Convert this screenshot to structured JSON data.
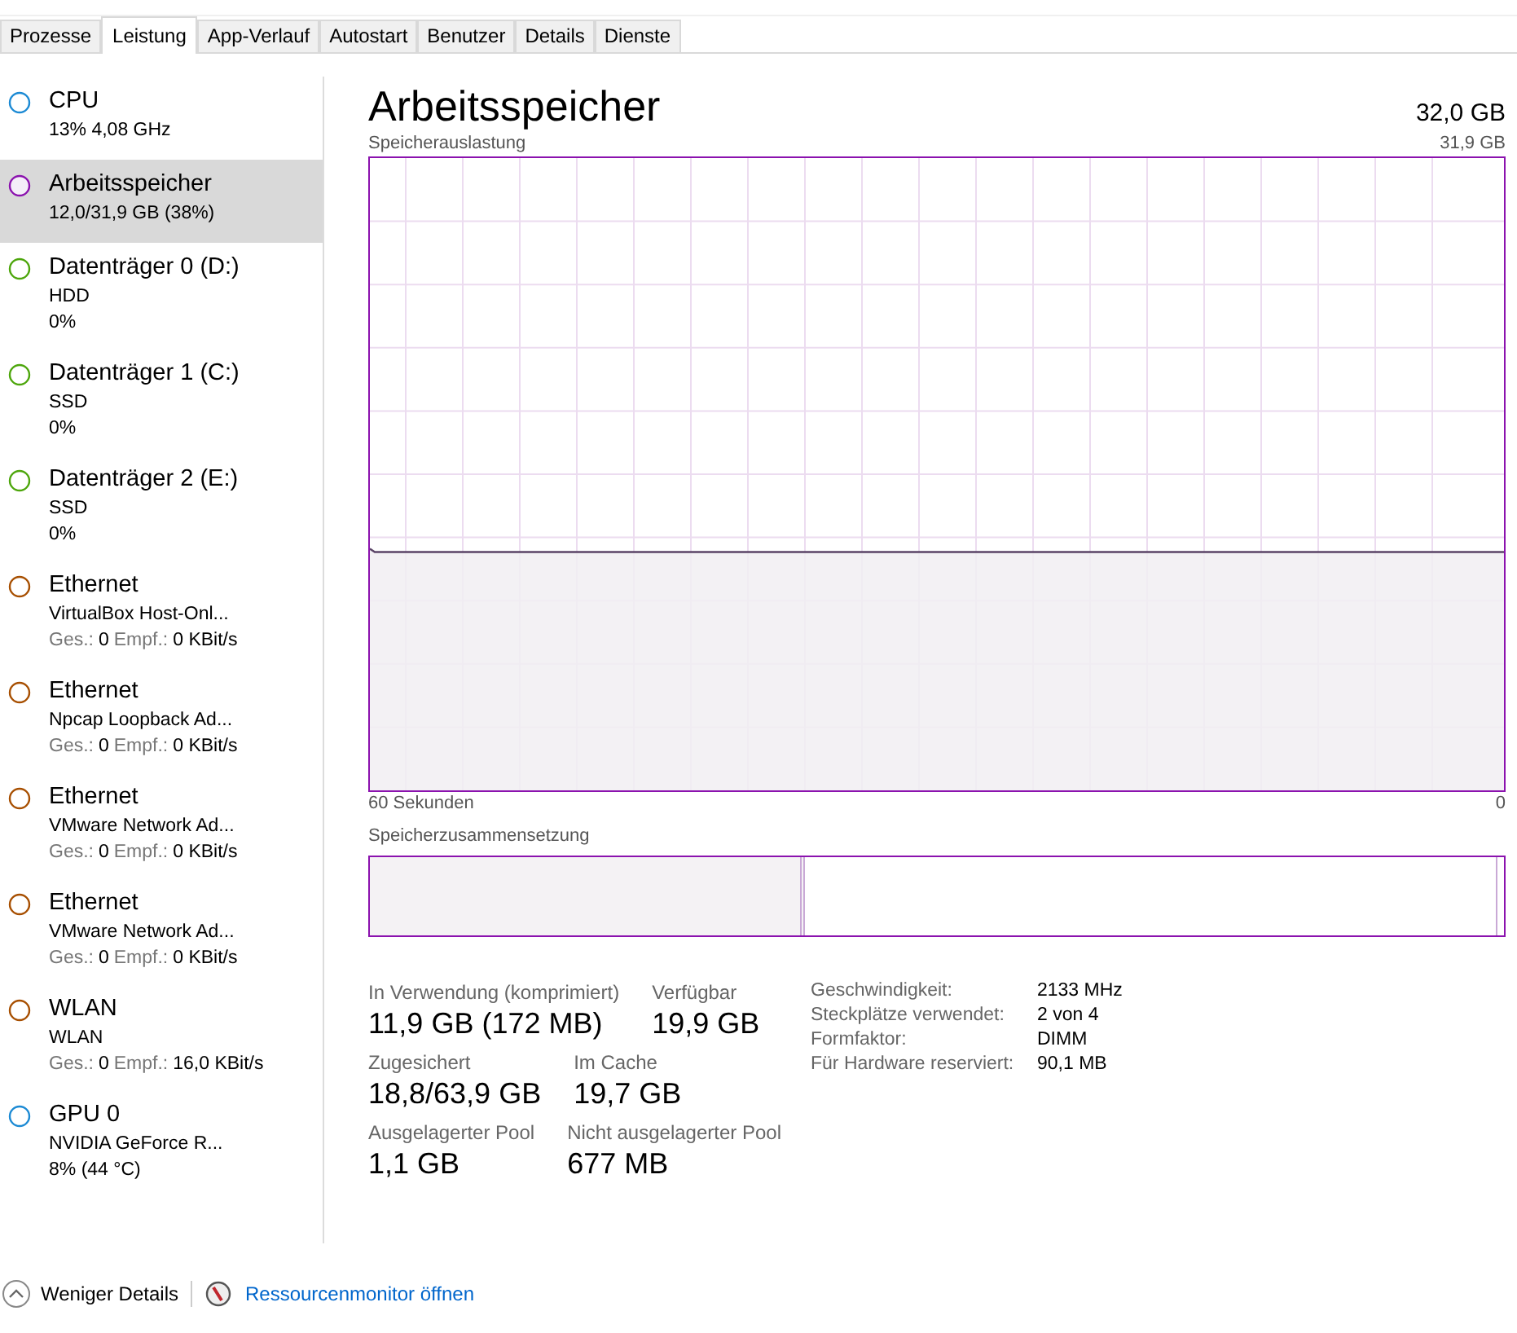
{
  "tabs": [
    {
      "label": "Prozesse",
      "selected": false
    },
    {
      "label": "Leistung",
      "selected": true
    },
    {
      "label": "App-Verlauf",
      "selected": false
    },
    {
      "label": "Autostart",
      "selected": false
    },
    {
      "label": "Benutzer",
      "selected": false
    },
    {
      "label": "Details",
      "selected": false
    },
    {
      "label": "Dienste",
      "selected": false
    }
  ],
  "sidebar": {
    "items": [
      {
        "name": "CPU",
        "color": "#1c8ad4",
        "selected": false,
        "lines": [
          {
            "kind": "text",
            "text": "13%  4,08 GHz"
          }
        ]
      },
      {
        "name": "Arbeitsspeicher",
        "color": "#8b12ae",
        "selected": true,
        "lines": [
          {
            "kind": "text",
            "text": "12,0/31,9 GB (38%)"
          }
        ]
      },
      {
        "name": "Datenträger 0 (D:)",
        "color": "#4da60c",
        "selected": false,
        "lines": [
          {
            "kind": "text",
            "text": "HDD"
          },
          {
            "kind": "text",
            "text": "0%"
          }
        ]
      },
      {
        "name": "Datenträger 1 (C:)",
        "color": "#4da60c",
        "selected": false,
        "lines": [
          {
            "kind": "text",
            "text": "SSD"
          },
          {
            "kind": "text",
            "text": "0%"
          }
        ]
      },
      {
        "name": "Datenträger 2 (E:)",
        "color": "#4da60c",
        "selected": false,
        "lines": [
          {
            "kind": "text",
            "text": "SSD"
          },
          {
            "kind": "text",
            "text": "0%"
          }
        ]
      },
      {
        "name": "Ethernet",
        "color": "#a74f01",
        "selected": false,
        "lines": [
          {
            "kind": "text",
            "text": "VirtualBox Host-Onl..."
          },
          {
            "kind": "throughput",
            "parts": [
              {
                "label": "Ges.:",
                "value": "0"
              },
              {
                "label": "Empf.:",
                "value": "0 KBit/s"
              }
            ]
          }
        ]
      },
      {
        "name": "Ethernet",
        "color": "#a74f01",
        "selected": false,
        "lines": [
          {
            "kind": "text",
            "text": "Npcap Loopback Ad..."
          },
          {
            "kind": "throughput",
            "parts": [
              {
                "label": "Ges.:",
                "value": "0"
              },
              {
                "label": "Empf.:",
                "value": "0 KBit/s"
              }
            ]
          }
        ]
      },
      {
        "name": "Ethernet",
        "color": "#a74f01",
        "selected": false,
        "lines": [
          {
            "kind": "text",
            "text": "VMware Network Ad..."
          },
          {
            "kind": "throughput",
            "parts": [
              {
                "label": "Ges.:",
                "value": "0"
              },
              {
                "label": "Empf.:",
                "value": "0 KBit/s"
              }
            ]
          }
        ]
      },
      {
        "name": "Ethernet",
        "color": "#a74f01",
        "selected": false,
        "lines": [
          {
            "kind": "text",
            "text": "VMware Network Ad..."
          },
          {
            "kind": "throughput",
            "parts": [
              {
                "label": "Ges.:",
                "value": "0"
              },
              {
                "label": "Empf.:",
                "value": "0 KBit/s"
              }
            ]
          }
        ]
      },
      {
        "name": "WLAN",
        "color": "#a74f01",
        "selected": false,
        "lines": [
          {
            "kind": "text",
            "text": "WLAN"
          },
          {
            "kind": "throughput",
            "parts": [
              {
                "label": "Ges.:",
                "value": "0"
              },
              {
                "label": "Empf.:",
                "value": "16,0 KBit/s"
              }
            ]
          }
        ]
      },
      {
        "name": "GPU 0",
        "color": "#1c8ad4",
        "selected": false,
        "lines": [
          {
            "kind": "text",
            "text": "NVIDIA GeForce R..."
          },
          {
            "kind": "text",
            "text": "8%  (44 °C)"
          }
        ]
      }
    ]
  },
  "main": {
    "title": "Arbeitsspeicher",
    "total": "32,0 GB",
    "usage_graph": {
      "label": "Speicherauslastung",
      "max": "31,9 GB",
      "left_label": "60 Sekunden",
      "right_label": "0"
    },
    "composition": {
      "label": "Speicherzusammensetzung",
      "level": 0.38
    },
    "stats": [
      [
        {
          "label": "In Verwendung (komprimiert)",
          "value": "11,9 GB (172 MB)"
        },
        {
          "label": "Verfügbar",
          "value": "19,9 GB"
        }
      ],
      [
        {
          "label": "Zugesichert",
          "value": "18,8/63,9 GB"
        },
        {
          "label": "Im Cache",
          "value": "19,7 GB"
        }
      ],
      [
        {
          "label": "Ausgelagerter Pool",
          "value": "1,1 GB"
        },
        {
          "label": "Nicht ausgelagerter Pool",
          "value": "677 MB"
        }
      ]
    ],
    "details": [
      {
        "label": "Geschwindigkeit:",
        "value": "2133 MHz"
      },
      {
        "label": "Steckplätze verwendet:",
        "value": "2 von 4"
      },
      {
        "label": "Formfaktor:",
        "value": "DIMM"
      },
      {
        "label": "Für Hardware reserviert:",
        "value": "90,1 MB"
      }
    ]
  },
  "footer": {
    "less_details": "Weniger Details",
    "resource_monitor": "Ressourcenmonitor öffnen"
  }
}
